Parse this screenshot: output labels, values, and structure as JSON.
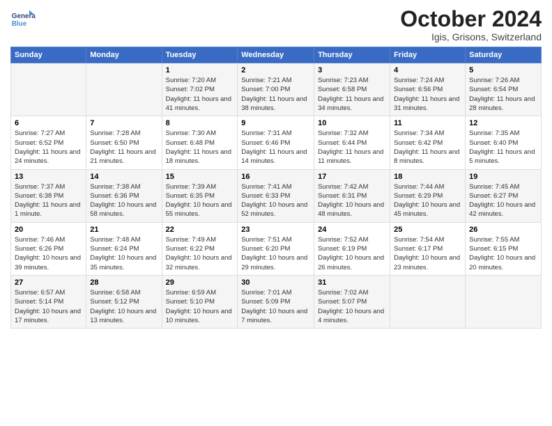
{
  "header": {
    "logo_general": "General",
    "logo_blue": "Blue",
    "month": "October 2024",
    "location": "Igis, Grisons, Switzerland"
  },
  "weekdays": [
    "Sunday",
    "Monday",
    "Tuesday",
    "Wednesday",
    "Thursday",
    "Friday",
    "Saturday"
  ],
  "weeks": [
    [
      {
        "day": "",
        "content": ""
      },
      {
        "day": "",
        "content": ""
      },
      {
        "day": "1",
        "content": "Sunrise: 7:20 AM\nSunset: 7:02 PM\nDaylight: 11 hours and 41 minutes."
      },
      {
        "day": "2",
        "content": "Sunrise: 7:21 AM\nSunset: 7:00 PM\nDaylight: 11 hours and 38 minutes."
      },
      {
        "day": "3",
        "content": "Sunrise: 7:23 AM\nSunset: 6:58 PM\nDaylight: 11 hours and 34 minutes."
      },
      {
        "day": "4",
        "content": "Sunrise: 7:24 AM\nSunset: 6:56 PM\nDaylight: 11 hours and 31 minutes."
      },
      {
        "day": "5",
        "content": "Sunrise: 7:26 AM\nSunset: 6:54 PM\nDaylight: 11 hours and 28 minutes."
      }
    ],
    [
      {
        "day": "6",
        "content": "Sunrise: 7:27 AM\nSunset: 6:52 PM\nDaylight: 11 hours and 24 minutes."
      },
      {
        "day": "7",
        "content": "Sunrise: 7:28 AM\nSunset: 6:50 PM\nDaylight: 11 hours and 21 minutes."
      },
      {
        "day": "8",
        "content": "Sunrise: 7:30 AM\nSunset: 6:48 PM\nDaylight: 11 hours and 18 minutes."
      },
      {
        "day": "9",
        "content": "Sunrise: 7:31 AM\nSunset: 6:46 PM\nDaylight: 11 hours and 14 minutes."
      },
      {
        "day": "10",
        "content": "Sunrise: 7:32 AM\nSunset: 6:44 PM\nDaylight: 11 hours and 11 minutes."
      },
      {
        "day": "11",
        "content": "Sunrise: 7:34 AM\nSunset: 6:42 PM\nDaylight: 11 hours and 8 minutes."
      },
      {
        "day": "12",
        "content": "Sunrise: 7:35 AM\nSunset: 6:40 PM\nDaylight: 11 hours and 5 minutes."
      }
    ],
    [
      {
        "day": "13",
        "content": "Sunrise: 7:37 AM\nSunset: 6:38 PM\nDaylight: 11 hours and 1 minute."
      },
      {
        "day": "14",
        "content": "Sunrise: 7:38 AM\nSunset: 6:36 PM\nDaylight: 10 hours and 58 minutes."
      },
      {
        "day": "15",
        "content": "Sunrise: 7:39 AM\nSunset: 6:35 PM\nDaylight: 10 hours and 55 minutes."
      },
      {
        "day": "16",
        "content": "Sunrise: 7:41 AM\nSunset: 6:33 PM\nDaylight: 10 hours and 52 minutes."
      },
      {
        "day": "17",
        "content": "Sunrise: 7:42 AM\nSunset: 6:31 PM\nDaylight: 10 hours and 48 minutes."
      },
      {
        "day": "18",
        "content": "Sunrise: 7:44 AM\nSunset: 6:29 PM\nDaylight: 10 hours and 45 minutes."
      },
      {
        "day": "19",
        "content": "Sunrise: 7:45 AM\nSunset: 6:27 PM\nDaylight: 10 hours and 42 minutes."
      }
    ],
    [
      {
        "day": "20",
        "content": "Sunrise: 7:46 AM\nSunset: 6:26 PM\nDaylight: 10 hours and 39 minutes."
      },
      {
        "day": "21",
        "content": "Sunrise: 7:48 AM\nSunset: 6:24 PM\nDaylight: 10 hours and 35 minutes."
      },
      {
        "day": "22",
        "content": "Sunrise: 7:49 AM\nSunset: 6:22 PM\nDaylight: 10 hours and 32 minutes."
      },
      {
        "day": "23",
        "content": "Sunrise: 7:51 AM\nSunset: 6:20 PM\nDaylight: 10 hours and 29 minutes."
      },
      {
        "day": "24",
        "content": "Sunrise: 7:52 AM\nSunset: 6:19 PM\nDaylight: 10 hours and 26 minutes."
      },
      {
        "day": "25",
        "content": "Sunrise: 7:54 AM\nSunset: 6:17 PM\nDaylight: 10 hours and 23 minutes."
      },
      {
        "day": "26",
        "content": "Sunrise: 7:55 AM\nSunset: 6:15 PM\nDaylight: 10 hours and 20 minutes."
      }
    ],
    [
      {
        "day": "27",
        "content": "Sunrise: 6:57 AM\nSunset: 5:14 PM\nDaylight: 10 hours and 17 minutes."
      },
      {
        "day": "28",
        "content": "Sunrise: 6:58 AM\nSunset: 5:12 PM\nDaylight: 10 hours and 13 minutes."
      },
      {
        "day": "29",
        "content": "Sunrise: 6:59 AM\nSunset: 5:10 PM\nDaylight: 10 hours and 10 minutes."
      },
      {
        "day": "30",
        "content": "Sunrise: 7:01 AM\nSunset: 5:09 PM\nDaylight: 10 hours and 7 minutes."
      },
      {
        "day": "31",
        "content": "Sunrise: 7:02 AM\nSunset: 5:07 PM\nDaylight: 10 hours and 4 minutes."
      },
      {
        "day": "",
        "content": ""
      },
      {
        "day": "",
        "content": ""
      }
    ]
  ]
}
